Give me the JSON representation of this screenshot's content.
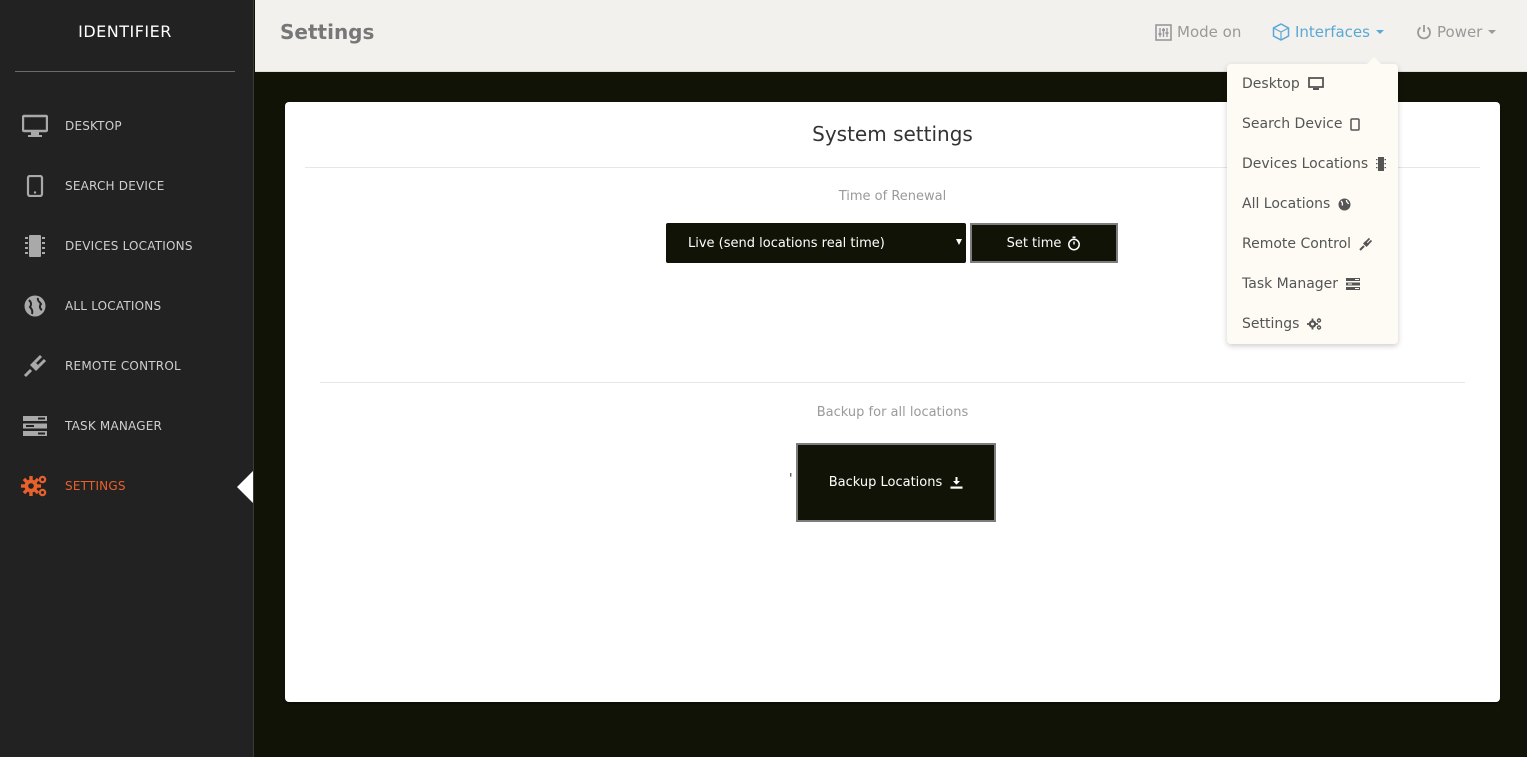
{
  "sidebar": {
    "brand": "IDENTIFIER",
    "items": [
      {
        "label": "DESKTOP",
        "icon": "desktop-icon"
      },
      {
        "label": "SEARCH DEVICE",
        "icon": "tablet-icon"
      },
      {
        "label": "DEVICES LOCATIONS",
        "icon": "chip-icon"
      },
      {
        "label": "ALL LOCATIONS",
        "icon": "globe-icon"
      },
      {
        "label": "REMOTE CONTROL",
        "icon": "plug-icon"
      },
      {
        "label": "TASK MANAGER",
        "icon": "tasks-icon"
      },
      {
        "label": "SETTINGS",
        "icon": "gears-icon",
        "active": true
      }
    ]
  },
  "header": {
    "title": "Settings",
    "mode": "Mode on",
    "interfaces": "Interfaces",
    "power": "Power"
  },
  "card": {
    "title": "System settings",
    "renewal_label": "Time of Renewal",
    "renewal_select": "Live (send locations real time)",
    "set_time": "Set time",
    "backup_label": "Backup for all locations",
    "stray_mark": "'",
    "backup_button": "Backup Locations"
  },
  "dropdown": {
    "items": [
      {
        "label": "Desktop",
        "icon": "desktop-icon"
      },
      {
        "label": "Search Device",
        "icon": "tablet-icon"
      },
      {
        "label": "Devices Locations",
        "icon": "chip-icon"
      },
      {
        "label": "All Locations",
        "icon": "globe-icon"
      },
      {
        "label": "Remote Control",
        "icon": "plug-icon"
      },
      {
        "label": "Task Manager",
        "icon": "tasks-icon"
      },
      {
        "label": "Settings",
        "icon": "gears-icon"
      }
    ]
  },
  "colors": {
    "sidebar_bg": "#222222",
    "content_bg": "#121307",
    "accent_active": "#e8612c",
    "link_blue": "#5ba8d6"
  }
}
